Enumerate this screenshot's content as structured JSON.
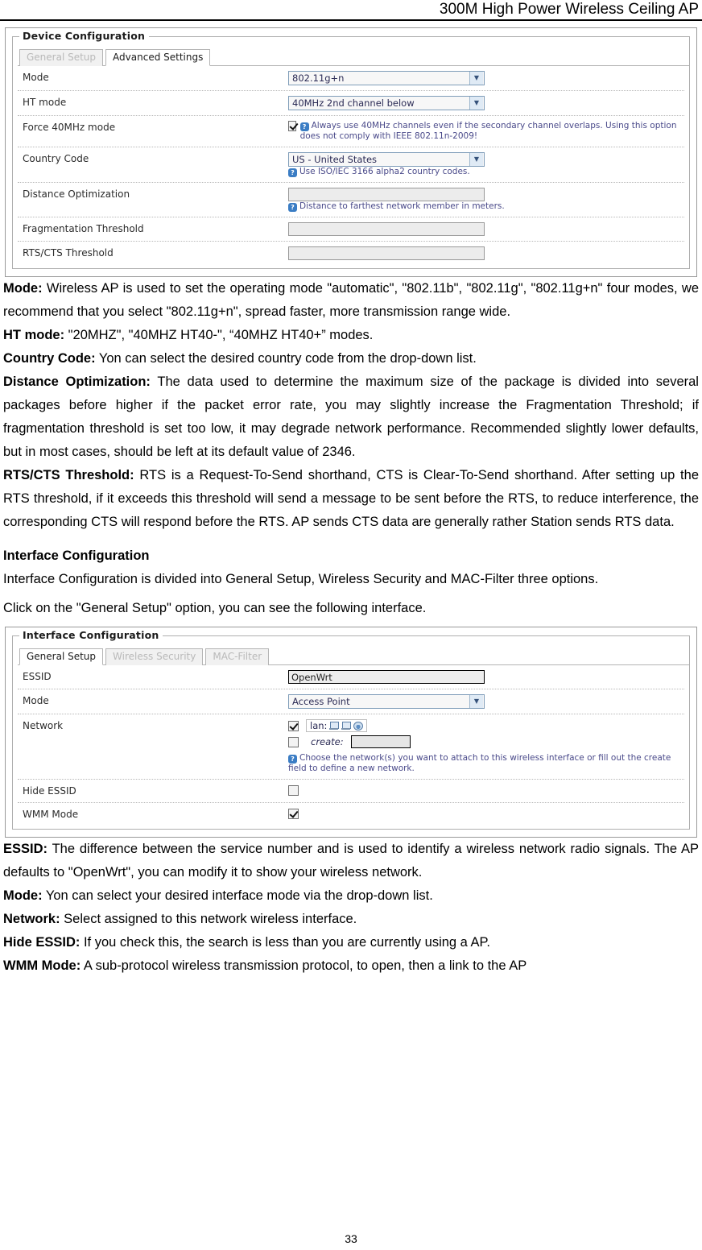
{
  "header": {
    "title": "300M High Power Wireless Ceiling AP"
  },
  "device_config": {
    "legend": "Device Configuration",
    "tabs": [
      {
        "label": "General Setup",
        "active": false
      },
      {
        "label": "Advanced Settings",
        "active": true
      }
    ],
    "rows": {
      "mode": {
        "label": "Mode",
        "value": "802.11g+n"
      },
      "ht_mode": {
        "label": "HT mode",
        "value": "40MHz 2nd channel below"
      },
      "force40": {
        "label": "Force 40MHz mode",
        "checked": true,
        "hint": "Always use 40MHz channels even if the secondary channel overlaps. Using this option does not comply with IEEE 802.11n-2009!"
      },
      "country_code": {
        "label": "Country Code",
        "value": "US - United States",
        "hint": "Use ISO/IEC 3166 alpha2 country codes."
      },
      "distance": {
        "label": "Distance Optimization",
        "value": "",
        "hint": "Distance to farthest network member in meters."
      },
      "fragmentation": {
        "label": "Fragmentation Threshold",
        "value": ""
      },
      "rtscts": {
        "label": "RTS/CTS Threshold",
        "value": ""
      }
    }
  },
  "interface_config": {
    "legend": "Interface Configuration",
    "tabs": [
      {
        "label": "General Setup",
        "active": true
      },
      {
        "label": "Wireless Security",
        "active": false
      },
      {
        "label": "MAC-Filter",
        "active": false
      }
    ],
    "rows": {
      "essid": {
        "label": "ESSID",
        "value": "OpenWrt"
      },
      "mode": {
        "label": "Mode",
        "value": "Access Point"
      },
      "network": {
        "label": "Network",
        "lan_label": "lan:",
        "lan_checked": true,
        "create_label": "create:",
        "create_checked": false,
        "create_value": "",
        "hint": "Choose the network(s) you want to attach to this wireless interface or fill out the create field to define a new network."
      },
      "hide_essid": {
        "label": "Hide ESSID",
        "checked": false
      },
      "wmm_mode": {
        "label": "WMM Mode",
        "checked": true
      }
    }
  },
  "body": {
    "p_mode_bold": "Mode:",
    "p_mode_text": " Wireless AP is used to set the operating mode \"automatic\", \"802.11b\", \"802.11g\", \"802.11g+n\" four modes, we recommend that you select \"802.11g+n\", spread faster, more transmission range wide.",
    "p_ht_bold": "HT mode:",
    "p_ht_text": " \"20MHZ\", \"40MHZ HT40-\", “40MHZ HT40+” modes.",
    "p_country_bold": "Country Code:",
    "p_country_text": " Yon can select the desired country code from the drop-down list.",
    "p_distance_bold": "Distance Optimization:",
    "p_distance_text": " The data used to determine the maximum size of the package is divided into several packages before higher if the packet error rate, you may slightly increase the Fragmentation Threshold; if fragmentation threshold is set too low, it may degrade network performance. Recommended slightly lower defaults, but in most cases, should be left at its default value of 2346.",
    "p_rts_bold": "RTS/CTS Threshold:",
    "p_rts_text": " RTS is a Request-To-Send shorthand, CTS is Clear-To-Send shorthand. After setting up the RTS threshold, if it exceeds this threshold will send a message to be sent before the RTS, to reduce interference, the corresponding CTS will respond before the RTS. AP sends CTS data are generally rather Station sends RTS data.",
    "h_interface": "Interface Configuration",
    "p_interface_text": "Interface Configuration is divided into General Setup, Wireless Security and MAC-Filter three options.",
    "p_click_text": "Click on the \"General Setup\" option, you can see the following interface.",
    "p_essid_bold": "ESSID:",
    "p_essid_text": " The difference between the service number and is used to identify a wireless network radio signals. The AP defaults to \"OpenWrt\", you can modify it to show your wireless network.",
    "p_mode2_bold": "Mode:",
    "p_mode2_text": " Yon can select your desired interface mode via the drop-down list.",
    "p_network_bold": "Network:",
    "p_network_text": " Select assigned to this network wireless interface.",
    "p_hide_bold": "Hide ESSID:",
    "p_hide_text": " If you check this, the search is less than you are currently using a AP.",
    "p_wmm_bold": "WMM Mode:",
    "p_wmm_text": " A sub-protocol wireless transmission protocol, to open, then a link to the AP"
  },
  "footer": {
    "page_number": "33"
  }
}
